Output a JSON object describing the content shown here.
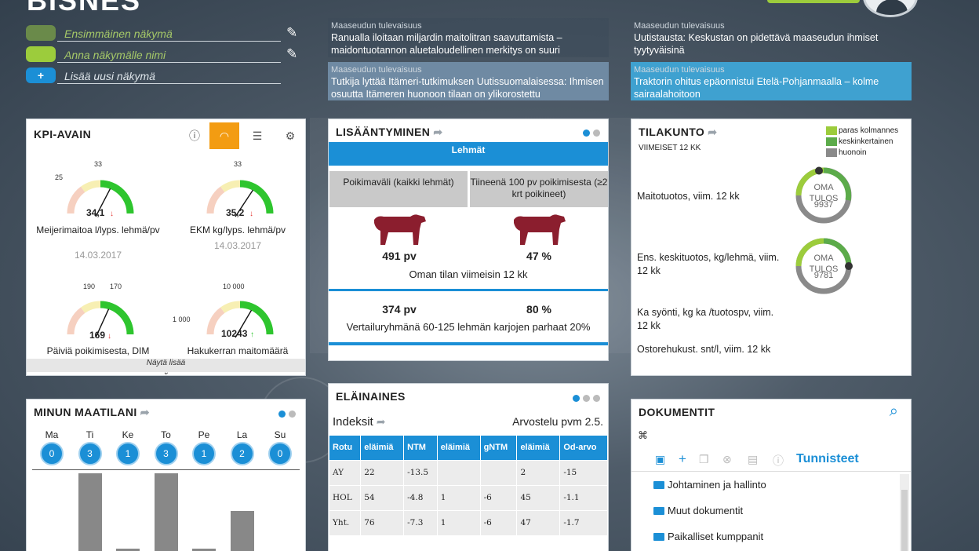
{
  "header": {
    "logo": "BISNES",
    "views": [
      {
        "label": "Ensimmäinen näkymä",
        "color": "#6a8a4a"
      },
      {
        "label": "Anna näkymälle nimi",
        "color": "#9ccc3c"
      },
      {
        "label": "Lisää uusi näkymä",
        "color": "#1b8fd6",
        "icon": "+"
      }
    ]
  },
  "news": [
    {
      "source": "Maaseudun tulevaisuus",
      "title": "Ranualla iloitaan miljardin maitolitran saavuttamista – maidontuotannon aluetaloudellinen merkitys on suuri"
    },
    {
      "source": "Maaseudun tulevaisuus",
      "title": "Uutistausta: Keskustan on pidettävä maaseudun ihmiset tyytyväisinä"
    },
    {
      "source": "Maaseudun tulevaisuus",
      "title": "Tutkija lyttää Itämeri-tutkimuksen Uutissuomalaisessa: Ihmisen osuutta Itämeren huonoon tilaan on ylikorostettu"
    },
    {
      "source": "Maaseudun tulevaisuus",
      "title": "Traktorin ohitus epäonnistui Etelä-Pohjanmaalla – kolme sairaalahoitoon"
    }
  ],
  "kpi": {
    "title": "KPI-AVAIN",
    "show_more": "Näytä lisää",
    "gauges": [
      {
        "label": "Meijerimaitoa l/lyps. lehmä/pv",
        "date": "14.03.2017",
        "value": "34,1",
        "trend": "down",
        "tick_left": "25",
        "tick_top": "33",
        "tick_right": "",
        "needle": 0.62
      },
      {
        "label": "EKM kg/lyps. lehmä/pv",
        "date": "14.03.2017",
        "value": "35,2",
        "trend": "down",
        "tick_left": "",
        "tick_top": "33",
        "tick_right": "",
        "needle": 0.66
      },
      {
        "label": "Päiviä poikimisesta, DIM",
        "date": "",
        "value": "169",
        "trend": "down",
        "tick_left": "190",
        "tick_top": "170",
        "tick_right": "",
        "needle": 0.6
      },
      {
        "label": "Hakukerran maitomäärä",
        "date": "",
        "value": "10243",
        "trend": "up",
        "tick_left": "1 000",
        "tick_top": "10 000",
        "tick_right": "",
        "needle": 0.64
      }
    ]
  },
  "lisaantyminen": {
    "title": "LISÄÄNTYMINEN",
    "subtitle": "Lehmät",
    "col1_header": "Poikimaväli (kaikki lehmät)",
    "col2_header": "Tiineenä 100 pv poikimisesta (≥2 krt poikineet)",
    "own_val1": "491 pv",
    "own_val2": "47 %",
    "own_caption": "Oman tilan viimeisin 12 kk",
    "cmp_val1": "374 pv",
    "cmp_val2": "80 %",
    "cmp_caption": "Vertailuryhmänä 60-125 lehmän karjojen parhaat 20%"
  },
  "tilakunto": {
    "title": "TILAKUNTO",
    "period": "VIIMEISET 12 KK",
    "legend": [
      {
        "label": "paras kolmannes",
        "color": "#9ccc3c"
      },
      {
        "label": "keskinkertainen",
        "color": "#5cab4a"
      },
      {
        "label": "huonoin",
        "color": "#8a8a8a"
      }
    ],
    "rows": [
      {
        "label": "Maitotuotos, viim. 12 kk",
        "ring_label": "OMA TULOS",
        "ring_value": "9937"
      },
      {
        "label": "Ens. keskituotos, kg/lehmä, viim. 12 kk",
        "ring_label": "OMA TULOS",
        "ring_value": "9781"
      },
      {
        "label": "Ka syönti, kg ka /tuotospv, viim. 12 kk"
      },
      {
        "label": "Ostorehukust. snt/l, viim. 12 kk"
      }
    ]
  },
  "maatila": {
    "title": "MINUN MAATILANI",
    "days": [
      {
        "name": "Ma",
        "count": "0",
        "bar": 0
      },
      {
        "name": "Ti",
        "count": "3",
        "bar": 3
      },
      {
        "name": "Ke",
        "count": "1",
        "bar": 1
      },
      {
        "name": "To",
        "count": "3",
        "bar": 3
      },
      {
        "name": "Pe",
        "count": "1",
        "bar": 1
      },
      {
        "name": "La",
        "count": "2",
        "bar": 2
      },
      {
        "name": "Su",
        "count": "0",
        "bar": 0
      }
    ]
  },
  "elainaines": {
    "title": "ELÄINAINES",
    "indeksit": "Indeksit",
    "arvostelu": "Arvostelu pvm 2.5.",
    "headers": [
      "Rotu",
      "eläimiä",
      "NTM",
      "eläimiä",
      "gNTM",
      "eläimiä",
      "Od-arvo"
    ],
    "rows": [
      [
        "AY",
        "22",
        "-13.5",
        "",
        "",
        "2",
        "-15"
      ],
      [
        "HOL",
        "54",
        "-4.8",
        "1",
        "-6",
        "45",
        "-1.1"
      ],
      [
        "Yht.",
        "76",
        "-7.3",
        "1",
        "-6",
        "47",
        "-1.7"
      ]
    ]
  },
  "dokumentit": {
    "title": "DOKUMENTIT",
    "tags_label": "Tunnisteet",
    "folders": [
      "Johtaminen ja hallinto",
      "Muut dokumentit",
      "Paikalliset kumppanit"
    ]
  },
  "colors": {
    "accent": "#1b8fd6",
    "green": "#9ccc3c",
    "orange": "#f39c12",
    "cow": "#8b1e2e"
  }
}
